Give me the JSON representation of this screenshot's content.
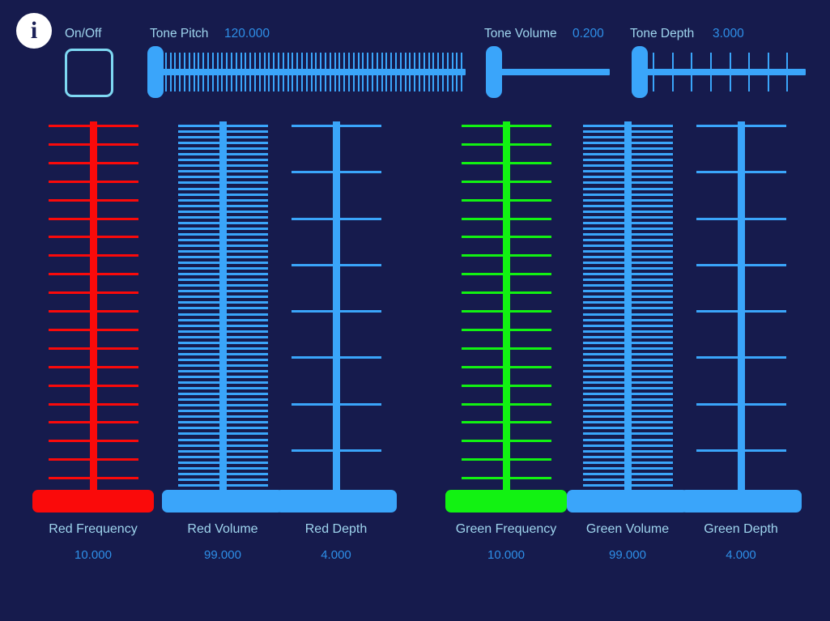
{
  "app": {
    "background_color": "#161B4D",
    "accent_blue": "#3AA5FA",
    "label_color": "#9FD5EE",
    "value_color": "#2E8FE8",
    "red_color": "#FA0A0A",
    "green_color": "#12F212"
  },
  "header": {
    "info_icon": "info-icon",
    "info_glyph": "i",
    "onoff": {
      "label": "On/Off",
      "checked": false
    },
    "tone_pitch": {
      "label": "Tone Pitch",
      "value": "120.000",
      "tick_count": 66,
      "handle_position": "left"
    },
    "tone_volume": {
      "label": "Tone Volume",
      "value": "0.200",
      "tick_count": 0,
      "handle_position": "left"
    },
    "tone_depth": {
      "label": "Tone Depth",
      "value": "3.000",
      "tick_count": 9,
      "handle_position": "left"
    }
  },
  "sliders": [
    {
      "name": "red-frequency",
      "label": "Red Frequency",
      "value": "10.000",
      "color": "c-red",
      "ticks": 21,
      "handle_position": "bottom"
    },
    {
      "name": "red-volume",
      "label": "Red Volume",
      "value": "99.000",
      "color": "c-blue",
      "ticks": 66,
      "handle_position": "bottom"
    },
    {
      "name": "red-depth",
      "label": "Red Depth",
      "value": "4.000",
      "color": "c-blue",
      "ticks": 9,
      "handle_position": "bottom"
    },
    {
      "name": "green-frequency",
      "label": "Green Frequency",
      "value": "10.000",
      "color": "c-green",
      "ticks": 21,
      "handle_position": "bottom"
    },
    {
      "name": "green-volume",
      "label": "Green Volume",
      "value": "99.000",
      "color": "c-blue",
      "ticks": 66,
      "handle_position": "bottom"
    },
    {
      "name": "green-depth",
      "label": "Green Depth",
      "value": "4.000",
      "color": "c-blue",
      "ticks": 9,
      "handle_position": "bottom"
    }
  ]
}
